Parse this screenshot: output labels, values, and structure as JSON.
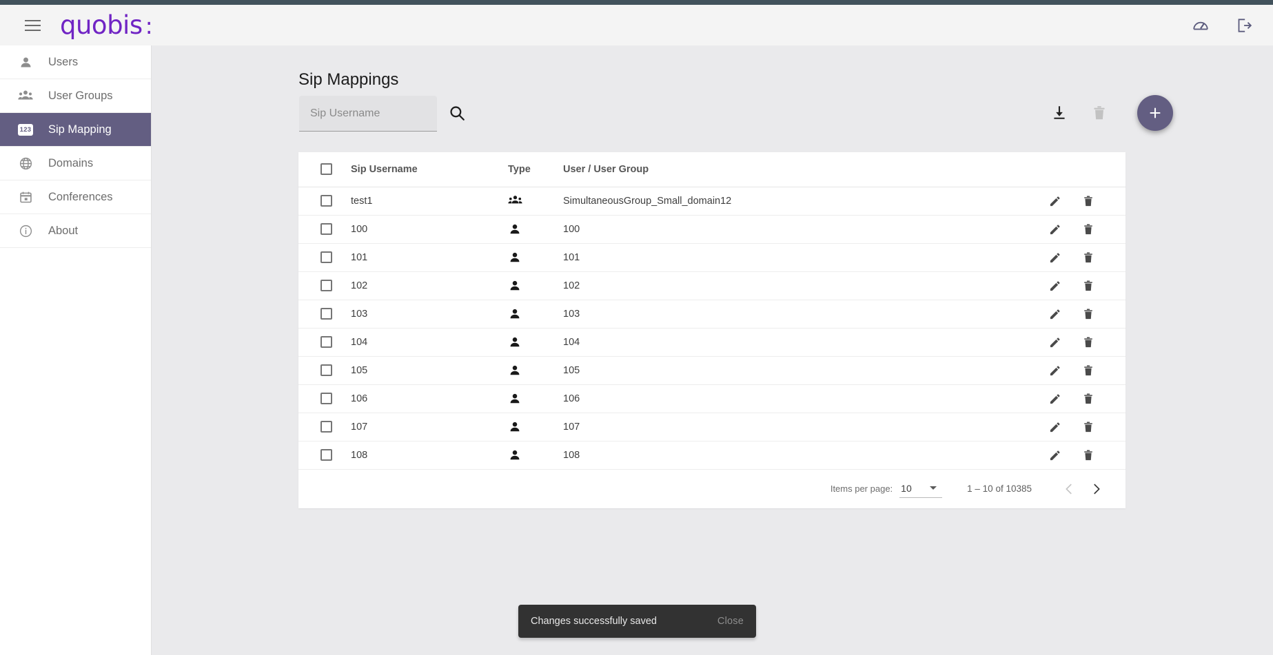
{
  "app": {
    "brand": "quobis",
    "brand_colon": ":",
    "brand_color": "#7024c4",
    "accent_color": "#635e82",
    "top_strip_color": "#42525c"
  },
  "header": {
    "menu_icon": "hamburger-menu-icon",
    "dashboard_icon": "speedometer-icon",
    "logout_icon": "logout-icon"
  },
  "sidebar": {
    "items": [
      {
        "label": "Users",
        "icon": "person-icon",
        "active": false
      },
      {
        "label": "User Groups",
        "icon": "group-icon",
        "active": false
      },
      {
        "label": "Sip Mapping",
        "icon": "123-badge-icon",
        "active": true
      },
      {
        "label": "Domains",
        "icon": "globe-icon",
        "active": false
      },
      {
        "label": "Conferences",
        "icon": "calendar-icon",
        "active": false
      },
      {
        "label": "About",
        "icon": "info-icon",
        "active": false
      }
    ]
  },
  "main": {
    "page_title": "Sip Mappings",
    "search": {
      "value": "",
      "placeholder": "Sip Username",
      "search_icon": "magnifier-icon"
    },
    "toolbar": {
      "download_icon": "download-icon",
      "download_enabled": true,
      "delete_icon": "trash-icon",
      "delete_enabled": false,
      "add_icon": "plus-icon",
      "add_label": "+"
    },
    "table": {
      "columns": [
        "Sip Username",
        "Type",
        "User / User Group"
      ],
      "select_all_checked": false,
      "rows": [
        {
          "checked": false,
          "sip_username": "test1",
          "type": "group",
          "user": "SimultaneousGroup_Small_domain12"
        },
        {
          "checked": false,
          "sip_username": "100",
          "type": "user",
          "user": "100"
        },
        {
          "checked": false,
          "sip_username": "101",
          "type": "user",
          "user": "101"
        },
        {
          "checked": false,
          "sip_username": "102",
          "type": "user",
          "user": "102"
        },
        {
          "checked": false,
          "sip_username": "103",
          "type": "user",
          "user": "103"
        },
        {
          "checked": false,
          "sip_username": "104",
          "type": "user",
          "user": "104"
        },
        {
          "checked": false,
          "sip_username": "105",
          "type": "user",
          "user": "105"
        },
        {
          "checked": false,
          "sip_username": "106",
          "type": "user",
          "user": "106"
        },
        {
          "checked": false,
          "sip_username": "107",
          "type": "user",
          "user": "107"
        },
        {
          "checked": false,
          "sip_username": "108",
          "type": "user",
          "user": "108"
        }
      ],
      "row_edit_icon": "pencil-icon",
      "row_delete_icon": "trash-icon"
    },
    "paginator": {
      "items_per_page_label": "Items per page:",
      "items_per_page_value": "10",
      "range_label": "1 – 10 of 10385",
      "prev_enabled": false,
      "next_enabled": true,
      "prev_icon": "chevron-left-icon",
      "next_icon": "chevron-right-icon"
    }
  },
  "snackbar": {
    "message": "Changes successfully saved",
    "action_label": "Close"
  }
}
